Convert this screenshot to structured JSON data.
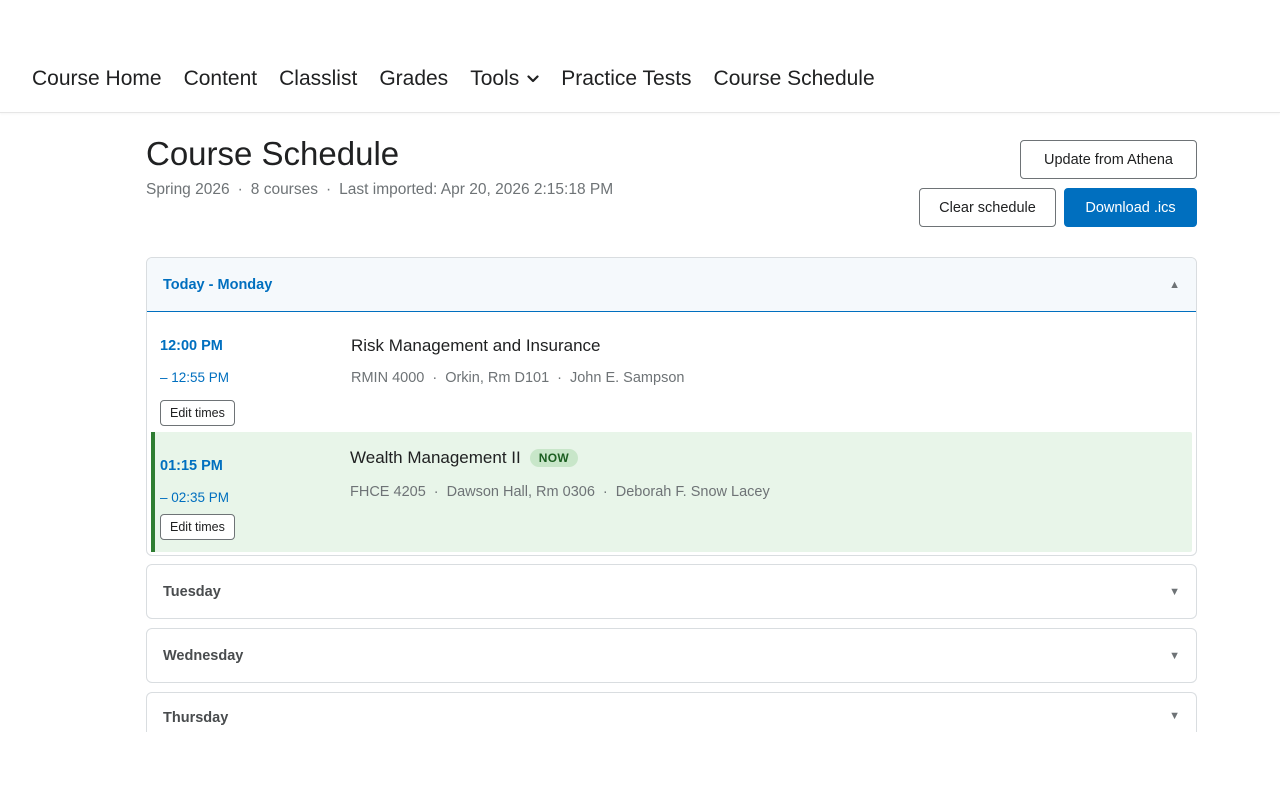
{
  "nav": {
    "items": [
      {
        "label": "Course Home"
      },
      {
        "label": "Content"
      },
      {
        "label": "Classlist"
      },
      {
        "label": "Grades"
      },
      {
        "label": "Tools"
      },
      {
        "label": "Practice Tests"
      },
      {
        "label": "Course Schedule"
      }
    ]
  },
  "header": {
    "title": "Course Schedule",
    "term": "Spring 2026",
    "course_count": "8 courses",
    "last_imported": "Last imported: Apr 20, 2026 2:15:18 PM",
    "separator": "·"
  },
  "actions": {
    "update_label": "Update from Athena",
    "clear_label": "Clear schedule",
    "download_label": "Download .ics"
  },
  "schedule": {
    "today": {
      "label": "Today - Monday",
      "caret": "▲",
      "entries": [
        {
          "start": "12:00 PM",
          "end": "– 12:55 PM",
          "edit_label": "Edit times",
          "title": "Risk Management and Insurance",
          "code": "RMIN 4000",
          "location": "Orkin, Rm D101",
          "instructor": "John E. Sampson"
        },
        {
          "start": "01:15 PM",
          "end": "– 02:35 PM",
          "edit_label": "Edit times",
          "title": "Wealth Management II",
          "badge": "NOW",
          "code": "FHCE 4205",
          "location": "Dawson Hall, Rm 0306",
          "instructor": "Deborah F. Snow Lacey"
        }
      ]
    },
    "days": [
      {
        "label": "Tuesday",
        "caret": "▼"
      },
      {
        "label": "Wednesday",
        "caret": "▼"
      },
      {
        "label": "Thursday",
        "caret": "▼"
      }
    ]
  },
  "colors": {
    "accent": "#006fbf",
    "now_bg": "#e8f5e9",
    "now_border": "#2e7d32"
  }
}
